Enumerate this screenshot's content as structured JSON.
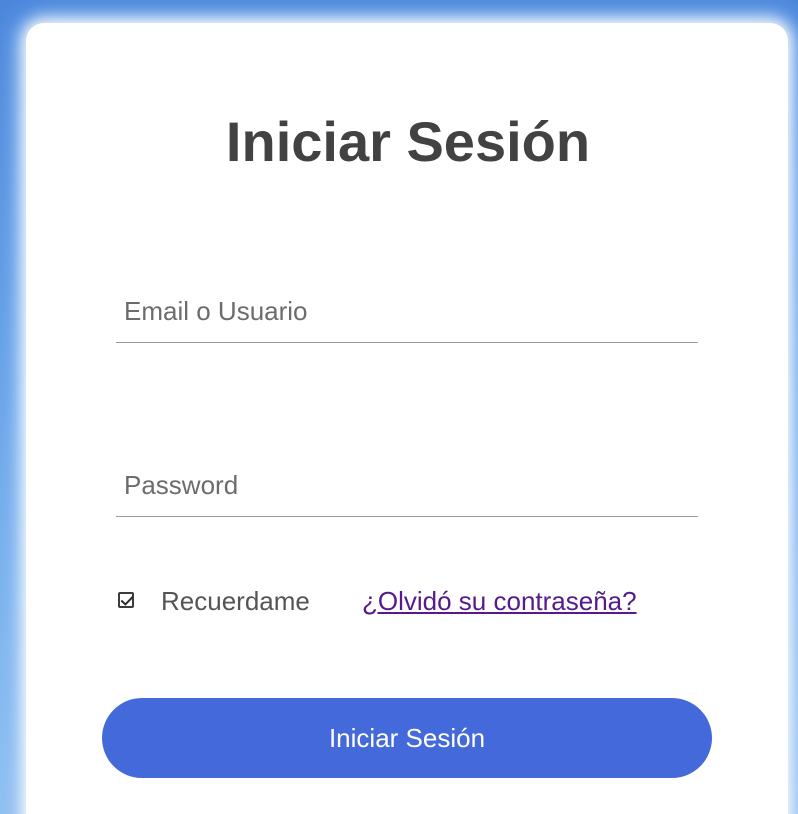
{
  "login": {
    "title": "Iniciar Sesión",
    "email_placeholder": "Email o Usuario",
    "email_value": "",
    "password_placeholder": "Password",
    "password_value": "",
    "remember_label": "Recuerdame",
    "remember_checked": true,
    "forgot_link": "¿Olvidó su contraseña?",
    "submit_label": "Iniciar Sesión"
  },
  "colors": {
    "accent": "#4369db",
    "background": "#5d9be6",
    "link": "#551a8b",
    "title": "#424242"
  },
  "icons": {
    "checkbox": "check-icon"
  }
}
